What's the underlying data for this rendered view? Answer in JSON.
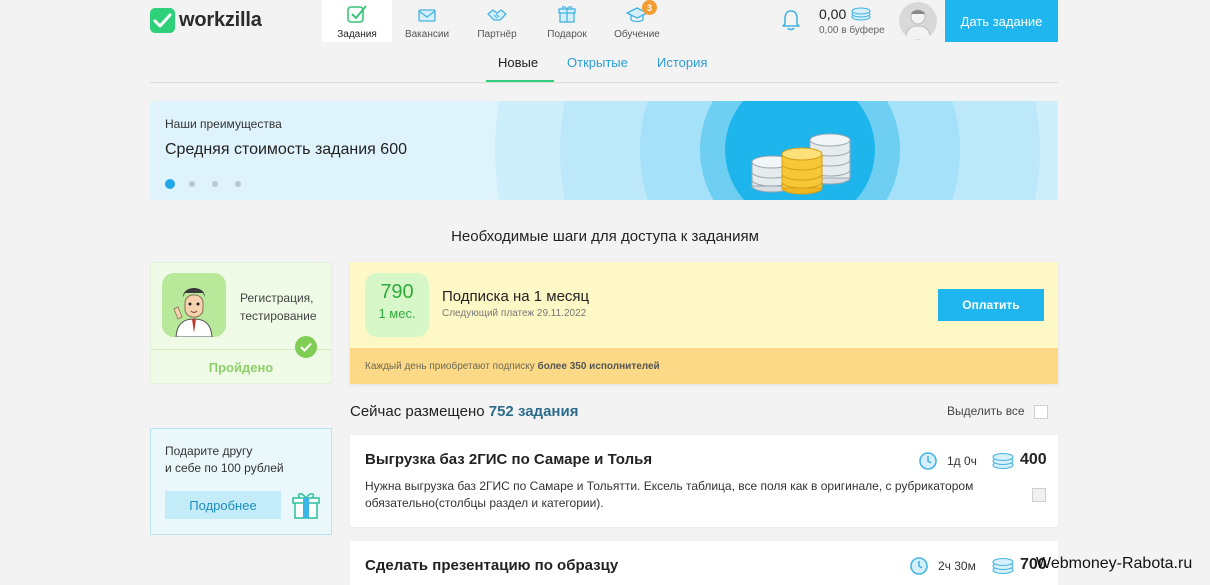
{
  "app": {
    "logo_text": "workzilla"
  },
  "nav": {
    "items": [
      {
        "label": "Задания",
        "icon": "task-check-icon",
        "active": true
      },
      {
        "label": "Вакансии",
        "icon": "envelope-icon"
      },
      {
        "label": "Партнёр",
        "icon": "handshake-icon"
      },
      {
        "label": "Подарок",
        "icon": "gift-icon"
      },
      {
        "label": "Обучение",
        "icon": "graduation-cap-icon",
        "badge": "3"
      }
    ]
  },
  "header": {
    "balance": "0,00",
    "buffer": "0,00 в буфере",
    "cta_label": "Дать задание"
  },
  "subtabs": [
    {
      "label": "Новые",
      "active": true
    },
    {
      "label": "Открытые"
    },
    {
      "label": "История"
    }
  ],
  "banner": {
    "kicker": "Наши преимущества",
    "title": "Средняя стоимость задания 600",
    "dots": 4,
    "active_dot": 1
  },
  "steps": {
    "title": "Необходимые шаги для доступа к заданиям",
    "registration": {
      "text_line1": "Регистрация,",
      "text_line2": "тестирование",
      "status": "Пройдено"
    },
    "subscription": {
      "price": "790",
      "period": "1 мес.",
      "title": "Подписка на 1 месяц",
      "next_payment": "Следующий платеж 29.11.2022",
      "pay_label": "Оплатить",
      "strip_prefix": "Каждый день приобретают подписку",
      "strip_bold": "более 350 исполнителей"
    }
  },
  "gift": {
    "line1": "Подарите другу",
    "line2": "и себе по 100 рублей",
    "button_label": "Подробнее"
  },
  "tasks": {
    "count_prefix": "Сейчас размещено",
    "count_value": "752 задания",
    "select_all": "Выделить все",
    "items": [
      {
        "title": "Выгрузка баз 2ГИС по Самаре и Толья",
        "time": "1д 0ч",
        "price": "400",
        "desc_line1": "Нужна выгрузка баз 2ГИС по Самаре и Тольятти. Ексель таблица, все поля как в оригинале, с рубрикатором",
        "desc_line2": "обязательно(столбцы раздел и категории)."
      },
      {
        "title": "Сделать презентацию по образцу",
        "time": "2ч 30м",
        "price": "700"
      }
    ]
  },
  "watermark": "Webmoney-Rabota.ru",
  "colors": {
    "brand_green": "#2fd07a",
    "accent_blue": "#1fb6ef",
    "link_blue": "#2a9fd6",
    "badge_orange": "#f39c32"
  }
}
